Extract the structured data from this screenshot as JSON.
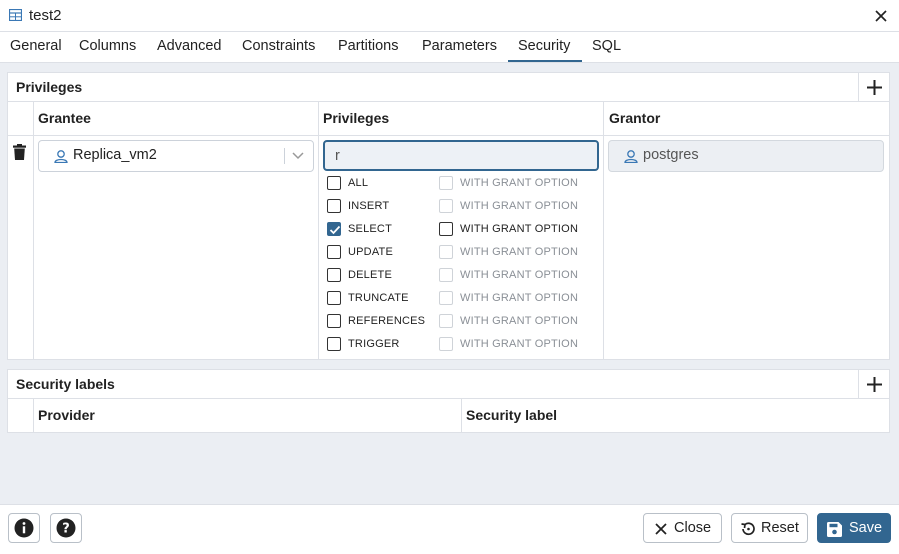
{
  "window": {
    "title": "test2",
    "close_icon": "close-icon",
    "table_icon": "table-icon"
  },
  "tabs": [
    {
      "label": "General",
      "active": false
    },
    {
      "label": "Columns",
      "active": false
    },
    {
      "label": "Advanced",
      "active": false
    },
    {
      "label": "Constraints",
      "active": false
    },
    {
      "label": "Partitions",
      "active": false
    },
    {
      "label": "Parameters",
      "active": false
    },
    {
      "label": "Security",
      "active": true
    },
    {
      "label": "SQL",
      "active": false
    }
  ],
  "privileges_panel": {
    "title": "Privileges",
    "columns": {
      "grantee": "Grantee",
      "privileges": "Privileges",
      "grantor": "Grantor"
    },
    "row": {
      "grantee": "Replica_vm2",
      "filter_value": "r",
      "grantor": "postgres",
      "privileges": [
        {
          "name": "ALL",
          "checked": false,
          "grant_option_label": "WITH GRANT OPTION",
          "grant_option_enabled": false
        },
        {
          "name": "INSERT",
          "checked": false,
          "grant_option_label": "WITH GRANT OPTION",
          "grant_option_enabled": false
        },
        {
          "name": "SELECT",
          "checked": true,
          "grant_option_label": "WITH GRANT OPTION",
          "grant_option_enabled": true
        },
        {
          "name": "UPDATE",
          "checked": false,
          "grant_option_label": "WITH GRANT OPTION",
          "grant_option_enabled": false
        },
        {
          "name": "DELETE",
          "checked": false,
          "grant_option_label": "WITH GRANT OPTION",
          "grant_option_enabled": false
        },
        {
          "name": "TRUNCATE",
          "checked": false,
          "grant_option_label": "WITH GRANT OPTION",
          "grant_option_enabled": false
        },
        {
          "name": "REFERENCES",
          "checked": false,
          "grant_option_label": "WITH GRANT OPTION",
          "grant_option_enabled": false
        },
        {
          "name": "TRIGGER",
          "checked": false,
          "grant_option_label": "WITH GRANT OPTION",
          "grant_option_enabled": false
        }
      ]
    }
  },
  "security_labels_panel": {
    "title": "Security labels",
    "columns": {
      "provider": "Provider",
      "label": "Security label"
    }
  },
  "footer": {
    "close_label": "Close",
    "reset_label": "Reset",
    "save_label": "Save"
  },
  "colors": {
    "accent": "#326690",
    "border": "#dde0e6",
    "background": "#ebeef3"
  }
}
